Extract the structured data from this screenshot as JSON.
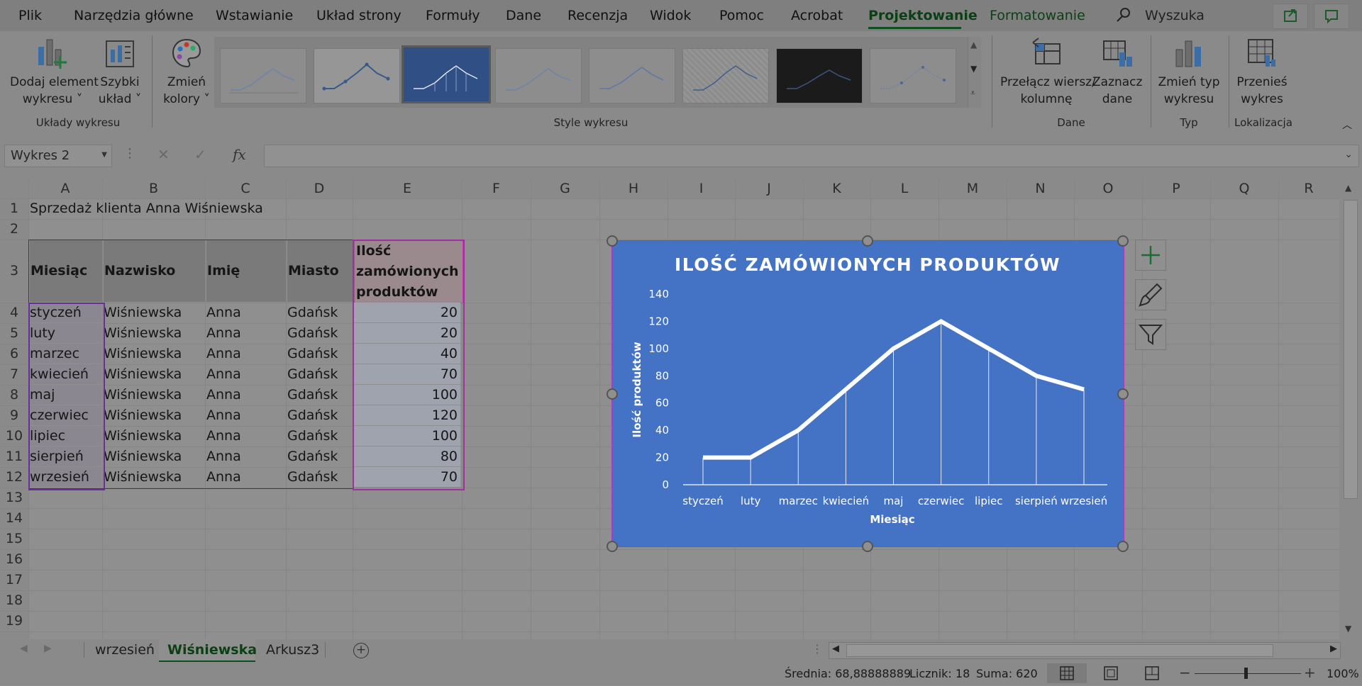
{
  "menu": {
    "items": [
      "Plik",
      "Narzędzia główne",
      "Wstawianie",
      "Układ strony",
      "Formuły",
      "Dane",
      "Recenzja",
      "Widok",
      "Pomoc",
      "Acrobat",
      "Projektowanie",
      "Formatowanie"
    ],
    "search_placeholder": "Wyszuka"
  },
  "ribbon": {
    "add_element": [
      "Dodaj element",
      "wykresu ˅"
    ],
    "quick_layout": [
      "Szybki",
      "układ ˅"
    ],
    "change_colors": [
      "Zmień",
      "kolory ˅"
    ],
    "group_layouts": "Układy wykresu",
    "group_styles": "Style wykresu",
    "switch_row_col": [
      "Przełącz wiersz/",
      "kolumnę"
    ],
    "select_data": [
      "Zaznacz",
      "dane"
    ],
    "group_data": "Dane",
    "change_type": [
      "Zmień typ",
      "wykresu"
    ],
    "group_type": "Typ",
    "move_chart": [
      "Przenieś",
      "wykres"
    ],
    "group_location": "Lokalizacja"
  },
  "formula_bar": {
    "name_box": "Wykres 2",
    "fx": "fx",
    "formula": ""
  },
  "sheet": {
    "columns": [
      "A",
      "B",
      "C",
      "D",
      "E",
      "F",
      "G",
      "H",
      "I",
      "J",
      "K",
      "L",
      "M",
      "N",
      "O",
      "P",
      "Q",
      "R"
    ],
    "rows": [
      "1",
      "2",
      "3",
      "4",
      "5",
      "6",
      "7",
      "8",
      "9",
      "10",
      "11",
      "12",
      "13",
      "14",
      "15",
      "16",
      "17",
      "18",
      "19"
    ],
    "title": "Sprzedaż klienta Anna Wiśniewska",
    "headers": [
      "Miesiąc",
      "Nazwisko",
      "Imię",
      "Miasto"
    ],
    "header_e": [
      "Ilość",
      "zamówionych",
      "produktów"
    ],
    "data": [
      [
        "styczeń",
        "Wiśniewska",
        "Anna",
        "Gdańsk",
        "20"
      ],
      [
        "luty",
        "Wiśniewska",
        "Anna",
        "Gdańsk",
        "20"
      ],
      [
        "marzec",
        "Wiśniewska",
        "Anna",
        "Gdańsk",
        "40"
      ],
      [
        "kwiecień",
        "Wiśniewska",
        "Anna",
        "Gdańsk",
        "70"
      ],
      [
        "maj",
        "Wiśniewska",
        "Anna",
        "Gdańsk",
        "100"
      ],
      [
        "czerwiec",
        "Wiśniewska",
        "Anna",
        "Gdańsk",
        "120"
      ],
      [
        "lipiec",
        "Wiśniewska",
        "Anna",
        "Gdańsk",
        "100"
      ],
      [
        "sierpień",
        "Wiśniewska",
        "Anna",
        "Gdańsk",
        "80"
      ],
      [
        "wrzesień",
        "Wiśniewska",
        "Anna",
        "Gdańsk",
        "70"
      ]
    ]
  },
  "chart_data": {
    "type": "line",
    "title": "ILOŚĆ ZAMÓWIONYCH PRODUKTÓW",
    "xlabel": "Miesiąc",
    "ylabel": "Ilość produktów",
    "categories": [
      "styczeń",
      "luty",
      "marzec",
      "kwiecień",
      "maj",
      "czerwiec",
      "lipiec",
      "sierpień",
      "wrzesień"
    ],
    "values": [
      20,
      20,
      40,
      70,
      100,
      120,
      100,
      80,
      70
    ],
    "ylim": [
      0,
      140
    ],
    "yticks": [
      "0",
      "20",
      "40",
      "60",
      "80",
      "100",
      "120",
      "140"
    ],
    "drop_lines": true,
    "background": "#4472c4",
    "line_color": "#ffffff"
  },
  "tabs": {
    "items": [
      "wrzesień",
      "Wiśniewska",
      "Arkusz3"
    ],
    "active": "Wiśniewska"
  },
  "status": {
    "average": "Średnia: 68,88888889",
    "count": "Licznik: 18",
    "sum": "Suma: 620",
    "zoom": "100%"
  }
}
